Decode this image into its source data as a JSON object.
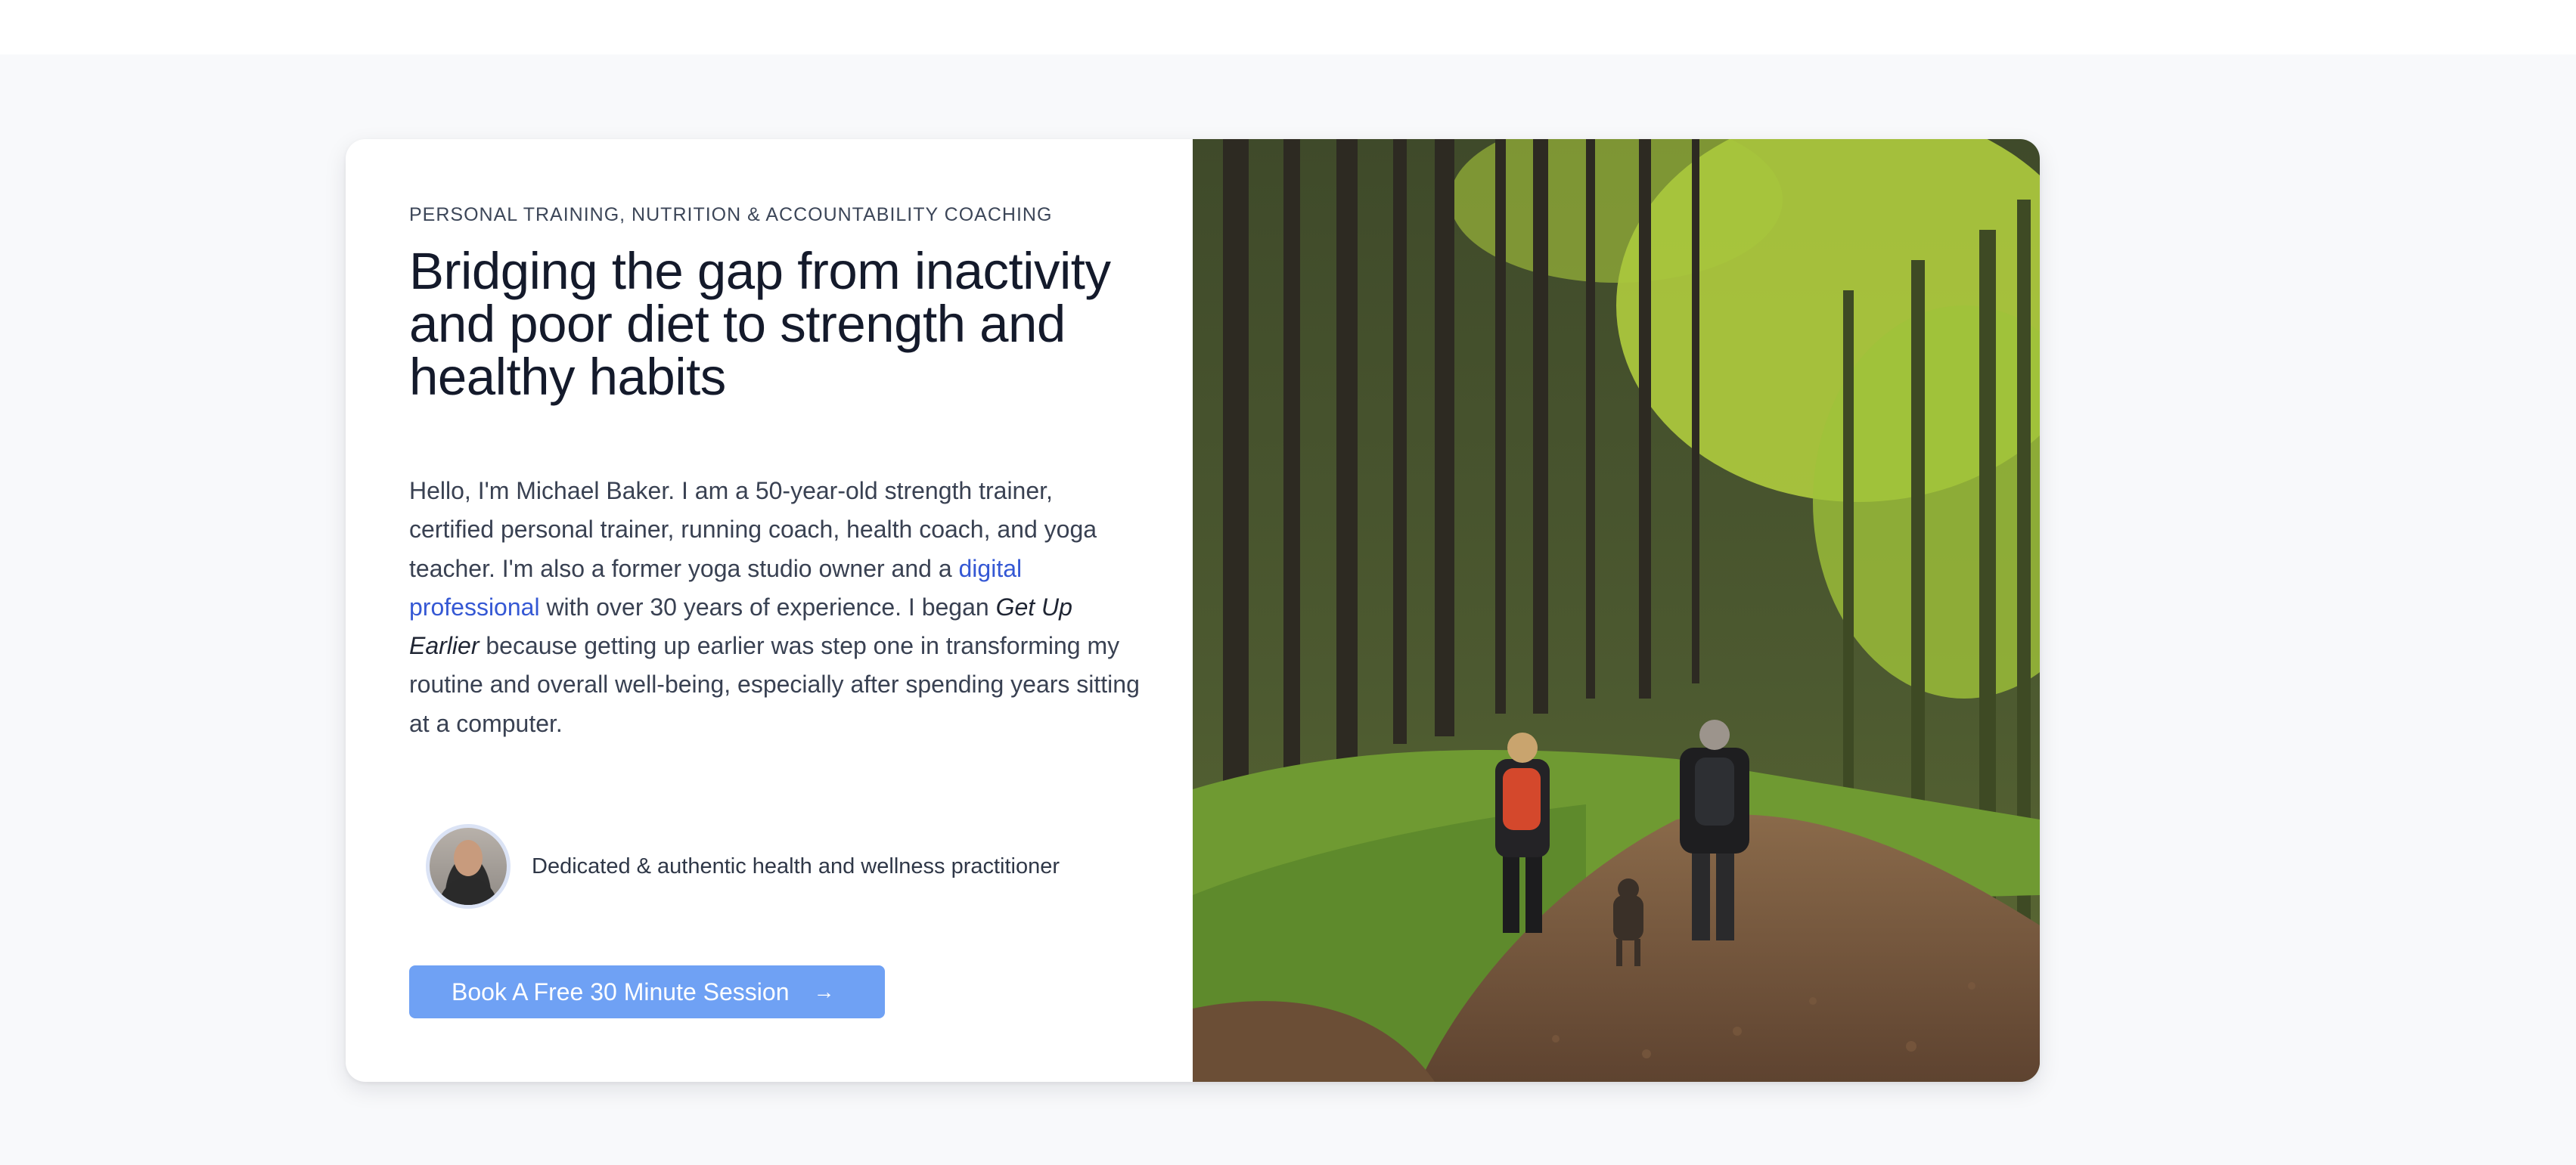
{
  "hero": {
    "eyebrow": "PERSONAL TRAINING, NUTRITION & ACCOUNTABILITY COACHING",
    "headline": "Bridging the gap from inactivity and poor diet to strength and healthy habits",
    "bio": {
      "intro": "Hello, I'm Michael Baker. I am a 50-year-old strength trainer, certified personal trainer, running coach, health coach, and yoga teacher. I'm also a former yoga studio owner and a ",
      "link_text": "digital professional",
      "mid": " with over 30 years of experience. I began ",
      "emphasis": "Get Up Earlier",
      "outro": " because getting up earlier was step one in transforming my routine and overall well-being, especially after spending years sitting at a computer."
    },
    "author_tagline": "Dedicated & authentic health and wellness practitioner",
    "cta_label": "Book A Free 30 Minute Session",
    "cta_icon": "arrow-right-icon"
  },
  "colors": {
    "accent_button": "#6fa1f4",
    "link": "#3558d4",
    "headline": "#141a2b",
    "section_bg": "#f8f9fb"
  }
}
